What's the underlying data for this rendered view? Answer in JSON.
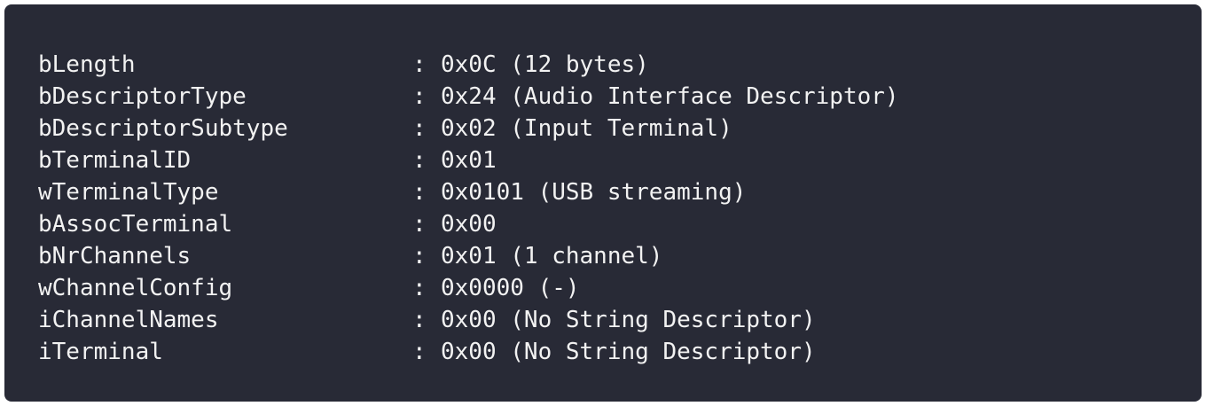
{
  "descriptor": {
    "separator": ":",
    "rows": [
      {
        "field": "bLength",
        "value": "0x0C (12 bytes)"
      },
      {
        "field": "bDescriptorType",
        "value": "0x24 (Audio Interface Descriptor)"
      },
      {
        "field": "bDescriptorSubtype",
        "value": "0x02 (Input Terminal)"
      },
      {
        "field": "bTerminalID",
        "value": "0x01"
      },
      {
        "field": "wTerminalType",
        "value": "0x0101 (USB streaming)"
      },
      {
        "field": "bAssocTerminal",
        "value": "0x00"
      },
      {
        "field": "bNrChannels",
        "value": "0x01 (1 channel)"
      },
      {
        "field": "wChannelConfig",
        "value": "0x0000 (-)"
      },
      {
        "field": "iChannelNames",
        "value": "0x00 (No String Descriptor)"
      },
      {
        "field": "iTerminal",
        "value": "0x00 (No String Descriptor)"
      }
    ]
  },
  "colors": {
    "background": "#282a36",
    "text": "#f2f2f2"
  }
}
